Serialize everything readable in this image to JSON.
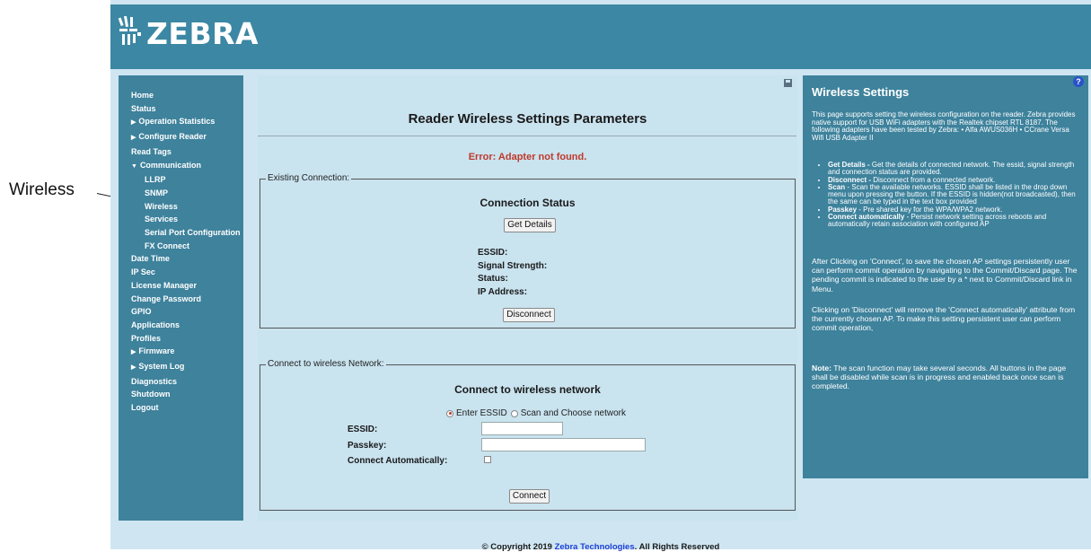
{
  "annotation": {
    "label": "Wireless"
  },
  "header": {
    "brand": "ZEBRA",
    "logo_icon": "zebra-head-icon"
  },
  "sidebar": {
    "items": [
      {
        "label": "Home"
      },
      {
        "label": "Status"
      },
      {
        "label": "Operation Statistics",
        "collapsed": true
      },
      {
        "label": "Configure Reader",
        "collapsed": true
      },
      {
        "label": "Read Tags"
      },
      {
        "label": "Communication",
        "expanded": true
      },
      {
        "label": "LLRP"
      },
      {
        "label": "SNMP"
      },
      {
        "label": "Wireless"
      },
      {
        "label": "Services"
      },
      {
        "label": "Serial Port Configuration"
      },
      {
        "label": "FX Connect"
      },
      {
        "label": "Date Time"
      },
      {
        "label": "IP Sec"
      },
      {
        "label": "License Manager"
      },
      {
        "label": "Change Password"
      },
      {
        "label": "GPIO"
      },
      {
        "label": "Applications"
      },
      {
        "label": "Profiles"
      },
      {
        "label": "Firmware",
        "collapsed": true
      },
      {
        "label": "System Log",
        "collapsed": true
      },
      {
        "label": "Diagnostics"
      },
      {
        "label": "Shutdown"
      },
      {
        "label": "Logout"
      }
    ]
  },
  "main": {
    "title": "Reader Wireless Settings Parameters",
    "error": "Error: Adapter not found.",
    "existing": {
      "legend": "Existing Connection:",
      "title": "Connection Status",
      "get_details_label": "Get Details",
      "fields": {
        "essid": "ESSID:",
        "signal": "Signal Strength:",
        "status": "Status:",
        "ip": "IP Address:"
      },
      "disconnect_label": "Disconnect"
    },
    "connect": {
      "legend": "Connect to wireless Network:",
      "title": "Connect to wireless network",
      "radio_enter": "Enter ESSID",
      "radio_scan": "Scan and Choose network",
      "essid_label": "ESSID:",
      "essid_value": "",
      "passkey_label": "Passkey:",
      "passkey_value": "",
      "auto_label": "Connect Automatically:",
      "auto_checked": false,
      "connect_label": "Connect"
    }
  },
  "help": {
    "title": "Wireless Settings",
    "intro": "This page supports setting the wireless configuration on the reader. Zebra provides native support for USB WiFi adapters with the Realtek chipset RTL 8187. The following adapters have been tested by Zebra: • Alfa AWUS036H • CCrane Versa Wifi USB Adapter II",
    "bullets": [
      {
        "term": "Get Details -",
        "text": " Get the details of connected network. The essid, signal strength and connection status are provided."
      },
      {
        "term": "Disconnect -",
        "text": " Disconnect from a connected network."
      },
      {
        "term": "Scan",
        "text": " - Scan the available networks. ESSID shall be listed in the drop down menu upon pressing the button. If the ESSID is hidden(not broadcasted), then the same can be typed in the text box provided"
      },
      {
        "term": "Passkey",
        "text": " - Pre shared key for the WPA/WPA2 network."
      },
      {
        "term": "Connect automatically",
        "text": " - Persist network setting across reboots and automatically retain association with configured AP"
      }
    ],
    "para1": "After Clicking on 'Connect', to save the chosen AP settings persistently user can perform commit operation by navigating to the Commit/Discard page. The pending commit is indicated to the user by a * next to Commit/Discard link in Menu.",
    "para2": "Clicking on 'Disconnect' will remove the 'Connect automatically' attribute from the currently chosen AP. To make this setting persistent user can perform commit operation,",
    "note_label": "Note:",
    "note_text": " The scan function may take several seconds. All buttons in the page shall be disabled while scan is in progress and enabled back once scan is completed."
  },
  "footer": {
    "prefix": "© Copyright 2019 ",
    "link": "Zebra Technologies",
    "suffix": ". All Rights Reserved"
  }
}
